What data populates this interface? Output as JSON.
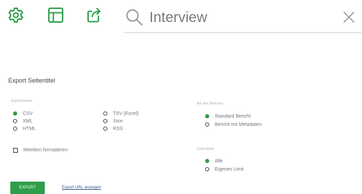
{
  "search": {
    "value": "Interview"
  },
  "panel": {
    "title": "Export Seitentitel",
    "format_label": "Exportformat",
    "formats": [
      "CSV",
      "XML",
      "HTML",
      "TSV (Excel)",
      "Json",
      "RSS"
    ],
    "selected_format": "CSV",
    "format_metrics_label": "Metriken formatieren",
    "report_type_label": "Art des Berichts",
    "report_types": [
      "Standard Bericht",
      "Bericht mit Metadaten"
    ],
    "selected_report_type": "Standard Bericht",
    "limit_label": "Zeilenlimit",
    "limits": [
      "Alle",
      "Eigenes Limit"
    ],
    "selected_limit": "Alle",
    "export_button": "EXPORT",
    "export_url_link": "Export URL anzeigen"
  },
  "colors": {
    "accent": "#2e9e4b",
    "text": "#444444",
    "muted": "#aaaaaa"
  },
  "icons": [
    "gear-icon",
    "table-icon",
    "share-export-icon",
    "search-icon",
    "close-icon"
  ]
}
